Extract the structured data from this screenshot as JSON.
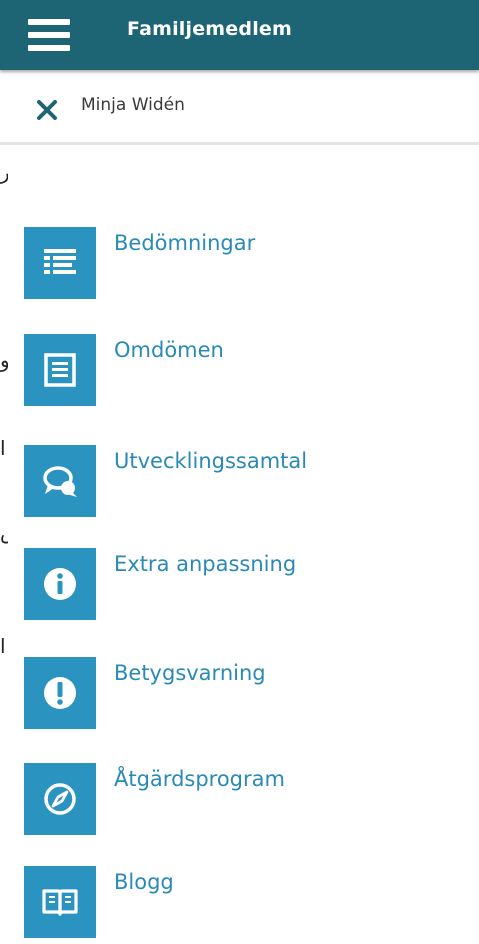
{
  "header": {
    "title": "Familjemedlem",
    "menu_icon": "hamburger-menu-icon"
  },
  "member": {
    "name": "Minja Widén",
    "close_icon": "close-icon"
  },
  "edge_glyphs": [
    "ر",
    "و",
    "ا",
    "س",
    "ا"
  ],
  "menu": {
    "items": [
      {
        "label": "Bedömningar",
        "icon": "list-icon"
      },
      {
        "label": "Omdömen",
        "icon": "document-icon"
      },
      {
        "label": "Utvecklingssamtal",
        "icon": "chat-bubble-icon"
      },
      {
        "label": "Extra anpassning",
        "icon": "info-icon"
      },
      {
        "label": "Betygsvarning",
        "icon": "exclamation-icon"
      },
      {
        "label": "Åtgärdsprogram",
        "icon": "compass-icon"
      },
      {
        "label": "Blogg",
        "icon": "book-icon"
      }
    ]
  },
  "colors": {
    "header_bg": "#1d6475",
    "tile_bg": "#2b93bf",
    "label_text": "#2a8ab6"
  }
}
